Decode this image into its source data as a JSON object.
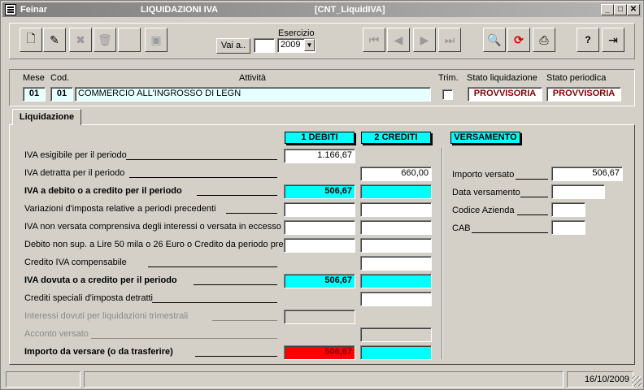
{
  "window": {
    "app_name": "Feinar",
    "title": "LIQUIDAZIONI IVA",
    "form_id": "[CNT_LiquidIVA]"
  },
  "toolbar": {
    "goto_label": "Vai a..",
    "goto_value": "",
    "esercizio_label": "Esercizio",
    "esercizio_value": "2009"
  },
  "header": {
    "mese_label": "Mese",
    "cod_label": "Cod.",
    "attivita_label": "Attività",
    "trim_label": "Trim.",
    "stato_liq_label": "Stato liquidazione",
    "stato_per_label": "Stato periodica",
    "mese_value": "01",
    "cod_value": "01",
    "attivita_value": "COMMERCIO ALL'INGROSSO DI LEGN",
    "stato_liq_value": "PROVVISORIA",
    "stato_per_value": "PROVVISORIA",
    "accent_color": "#800000"
  },
  "tab": {
    "label": "Liquidazione"
  },
  "columns": {
    "debiti": "1  DEBITI",
    "crediti": "2  CREDITI",
    "versamento": "VERSAMENTO"
  },
  "rows": [
    {
      "label": "IVA esigibile per il periodo",
      "debiti": "1.166,67",
      "crediti": null
    },
    {
      "label": "IVA detratta per il periodo",
      "debiti": null,
      "crediti": "660,00"
    },
    {
      "label": "IVA a debito o a credito per il periodo",
      "debiti": "506,67",
      "crediti": ""
    },
    {
      "label": "Variazioni d'imposta relative a periodi precedenti",
      "debiti": "",
      "crediti": ""
    },
    {
      "label": "IVA non versata comprensiva degli interessi o versata in eccesso",
      "debiti": "",
      "crediti": ""
    },
    {
      "label": "Debito non sup. a Lire 50 mila o 26 Euro o Credito da periodo pre.",
      "debiti": "",
      "crediti": ""
    },
    {
      "label": "Credito IVA compensabile",
      "debiti": null,
      "crediti": ""
    },
    {
      "label": "IVA dovuta o a credito per il periodo",
      "debiti": "506,67",
      "crediti": ""
    },
    {
      "label": "Crediti speciali d'imposta detratti",
      "debiti": null,
      "crediti": ""
    },
    {
      "label": "Interessi dovuti per liquidazioni trimestrali",
      "debiti": "",
      "crediti": null
    },
    {
      "label": "Acconto versato",
      "debiti": null,
      "crediti": ""
    },
    {
      "label": "Importo da versare (o da trasferire)",
      "debiti": "506,67",
      "crediti": ""
    }
  ],
  "versamento": {
    "importo_label": "Importo versato",
    "importo_value": "506,67",
    "data_label": "Data versamento",
    "data_value": "",
    "codice_label": "Codice Azienda",
    "codice_value": "",
    "cab_label": "CAB",
    "cab_value": ""
  },
  "status_bar": {
    "date": "16/10/2009"
  },
  "icons": [
    "new-record-icon",
    "edit-record-icon",
    "cancel-icon",
    "delete-icon",
    "save-icon",
    "first-record-icon",
    "previous-record-icon",
    "next-record-icon",
    "last-record-icon",
    "preview-icon",
    "refresh-icon",
    "print-icon",
    "help-icon",
    "exit-icon"
  ]
}
